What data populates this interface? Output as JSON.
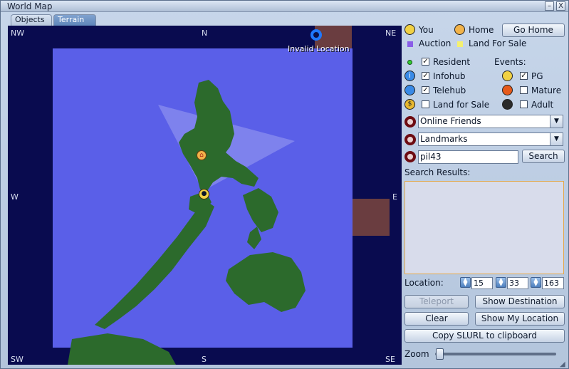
{
  "window": {
    "title": "World Map",
    "minimize": "–",
    "close": "X"
  },
  "tabs": [
    {
      "label": "Objects"
    },
    {
      "label": "Terrain"
    }
  ],
  "map": {
    "compass": {
      "nw": "NW",
      "n": "N",
      "ne": "NE",
      "w": "W",
      "e": "E",
      "sw": "SW",
      "s": "S",
      "se": "SE"
    },
    "invalid_location_label": "Invalid Location"
  },
  "legend": {
    "you": "You",
    "home": "Home",
    "go_home": "Go Home",
    "auction": "Auction",
    "land_for_sale": "Land For Sale",
    "events": "Events:"
  },
  "filters": {
    "resident": {
      "label": "Resident",
      "checked": true
    },
    "infohub": {
      "label": "Infohub",
      "checked": true
    },
    "telehub": {
      "label": "Telehub",
      "checked": true
    },
    "land_for_sale": {
      "label": "Land for Sale",
      "checked": false
    },
    "pg": {
      "label": "PG",
      "checked": true
    },
    "mature": {
      "label": "Mature",
      "checked": false
    },
    "adult": {
      "label": "Adult",
      "checked": false
    }
  },
  "friends_combo": {
    "value": "Online Friends"
  },
  "landmarks_combo": {
    "value": "Landmarks"
  },
  "search": {
    "value": "pil43",
    "button": "Search",
    "results_label": "Search Results:"
  },
  "location": {
    "label": "Location:",
    "x": "15",
    "y": "33",
    "z": "163"
  },
  "buttons": {
    "teleport": "Teleport",
    "show_destination": "Show Destination",
    "clear": "Clear",
    "show_my_location": "Show My Location",
    "copy_slurl": "Copy SLURL to clipboard"
  },
  "zoom": {
    "label": "Zoom",
    "level": 0.03
  },
  "colors": {
    "water": "#5a5fe8",
    "void": "#090b4f",
    "land": "#2c6a2c",
    "region_unavailable": "#6a3d40",
    "selection_outline": "#e3a84b"
  }
}
